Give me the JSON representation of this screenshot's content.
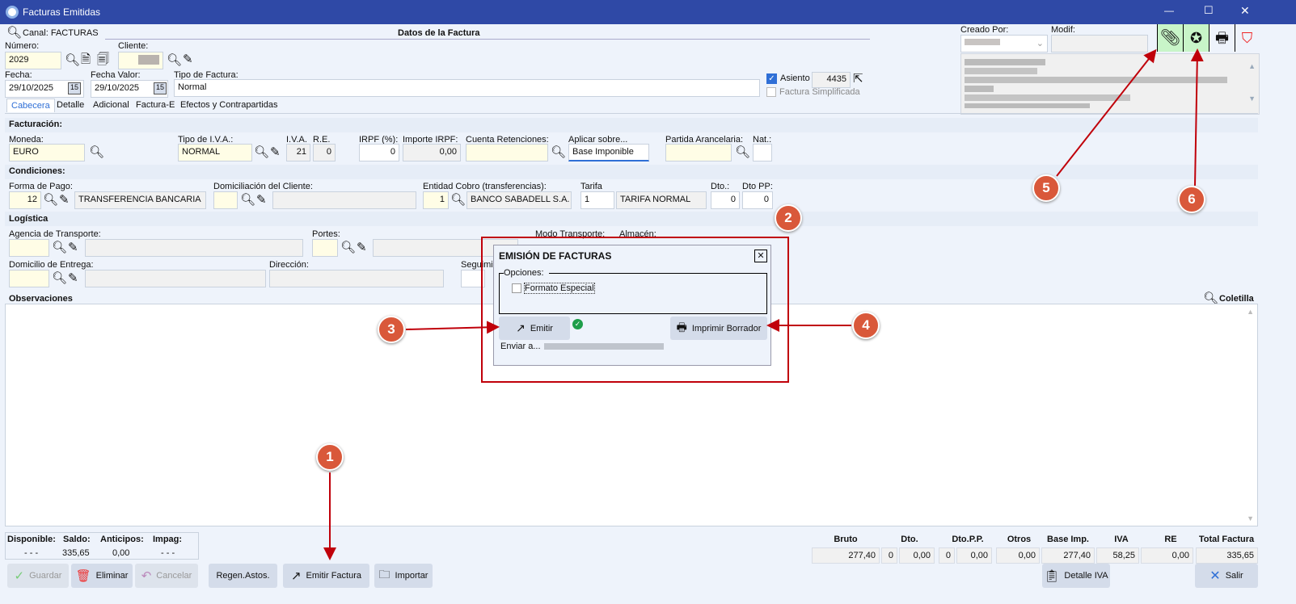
{
  "window": {
    "title": "Facturas Emitidas",
    "minimize": "—",
    "maximize": "☐",
    "close": "✕"
  },
  "header": {
    "canal_label": "Canal: FACTURAS",
    "section_title": "Datos de la Factura",
    "numero_label": "Número:",
    "numero": "2029",
    "cliente_label": "Cliente:",
    "fecha_label": "Fecha:",
    "fecha": "29/10/2025",
    "fecha_valor_label": "Fecha Valor:",
    "fecha_valor": "29/10/2025",
    "tipo_factura_label": "Tipo de Factura:",
    "tipo_factura": "Normal",
    "asiento_label": "Asiento",
    "asiento_checked": true,
    "asiento_num": "4435",
    "simplificada_label": "Factura Simplificada",
    "creado_por_label": "Creado Por:",
    "modif_label": "Modif:"
  },
  "tabs": [
    "Cabecera",
    "Detalle",
    "Adicional",
    "Factura-E",
    "Efectos y Contrapartidas"
  ],
  "facturacion": {
    "title": "Facturación:",
    "moneda_label": "Moneda:",
    "moneda": "EURO",
    "tipo_iva_label": "Tipo de I.V.A.:",
    "tipo_iva": "NORMAL",
    "iva_label": "I.V.A.",
    "iva": "21",
    "re_label": "R.E.",
    "re": "0",
    "irpf_label": "IRPF (%):",
    "irpf": "0",
    "importe_irpf_label": "Importe IRPF:",
    "importe_irpf": "0,00",
    "cuenta_ret_label": "Cuenta Retenciones:",
    "aplicar_label": "Aplicar sobre...",
    "aplicar": "Base Imponible",
    "partida_label": "Partida Arancelaria:",
    "nat_label": "Nat.:"
  },
  "condiciones": {
    "title": "Condiciones:",
    "forma_pago_label": "Forma de Pago:",
    "forma_pago_code": "12",
    "forma_pago": "TRANSFERENCIA BANCARIA",
    "domiciliacion_label": "Domiciliación del Cliente:",
    "entidad_label": "Entidad Cobro (transferencias):",
    "entidad_code": "1",
    "entidad": "BANCO SABADELL S.A.",
    "tarifa_label": "Tarifa",
    "tarifa_code": "1",
    "tarifa": "TARIFA NORMAL",
    "dto_label": "Dto.:",
    "dto": "0",
    "dtopp_label": "Dto PP:",
    "dtopp": "0"
  },
  "logistica": {
    "title": "Logística",
    "agencia_label": "Agencia de Transporte:",
    "portes_label": "Portes:",
    "modo_label": "Modo Transporte:",
    "almacen_label": "Almacén:",
    "domicilio_label": "Domicilio de Entrega:",
    "direccion_label": "Dirección:",
    "seguimiento_label": "Seguimie"
  },
  "observaciones": {
    "title": "Observaciones",
    "coletilla": "Coletilla"
  },
  "dialog": {
    "title": "EMISIÓN DE FACTURAS",
    "opciones": "Opciones:",
    "formato_especial": "Formato Especial",
    "emitir": "Emitir",
    "imprimir_borrador": "Imprimir Borrador",
    "enviar": "Enviar a..."
  },
  "saldo": {
    "headers": [
      "Disponible:",
      "Saldo:",
      "Anticipos:",
      "Impag:"
    ],
    "values": [
      "- - -",
      "335,65",
      "0,00",
      "- - -"
    ]
  },
  "totals": {
    "headers": [
      "Bruto",
      "Dto.",
      "Dto.P.P.",
      "Otros",
      "Base Imp.",
      "IVA",
      "RE",
      "Total Factura"
    ],
    "bruto": "277,40",
    "dto_pct": "0",
    "dto": "0,00",
    "dtopp_pct": "0",
    "dtopp": "0,00",
    "otros": "0,00",
    "base": "277,40",
    "iva": "58,25",
    "re": "0,00",
    "total": "335,65"
  },
  "buttons": {
    "guardar": "Guardar",
    "eliminar": "Eliminar",
    "cancelar": "Cancelar",
    "regen": "Regen.Astos.",
    "emitir_factura": "Emitir Factura",
    "importar": "Importar",
    "detalle_iva": "Detalle IVA",
    "salir": "Salir"
  },
  "annotations": [
    "1",
    "2",
    "3",
    "4",
    "5",
    "6"
  ],
  "colors": {
    "titlebar": "#2f49a6",
    "annotation": "#d9583a",
    "highlight": "#c0000a",
    "green_button": "#c8f5c8"
  }
}
